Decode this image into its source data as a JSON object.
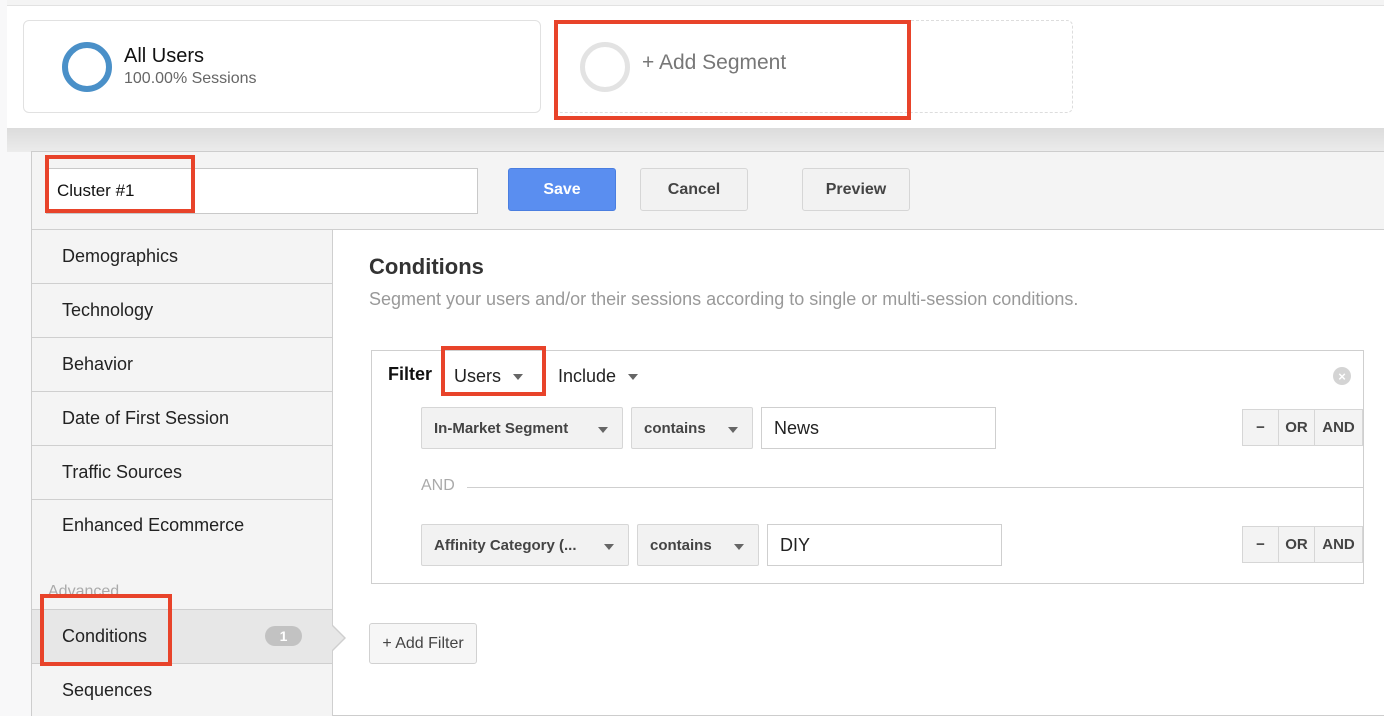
{
  "segments": {
    "active": {
      "title": "All Users",
      "subtitle": "100.00% Sessions",
      "ring_color": "#4a90c8"
    },
    "add_label": "+ Add Segment"
  },
  "editor": {
    "segment_name": "Cluster #1",
    "buttons": {
      "save": "Save",
      "cancel": "Cancel",
      "preview": "Preview"
    },
    "save_color": "#5a8ef0"
  },
  "sidebar": {
    "items": [
      {
        "label": "Demographics"
      },
      {
        "label": "Technology"
      },
      {
        "label": "Behavior"
      },
      {
        "label": "Date of First Session"
      },
      {
        "label": "Traffic Sources"
      },
      {
        "label": "Enhanced Ecommerce"
      }
    ],
    "advanced_label": "Advanced",
    "advanced_items": [
      {
        "label": "Conditions",
        "badge": "1",
        "active": true
      },
      {
        "label": "Sequences"
      }
    ]
  },
  "conditions": {
    "title": "Conditions",
    "description": "Segment your users and/or their sessions according to single or multi-session conditions.",
    "filter": {
      "label": "Filter",
      "scope": "Users",
      "mode": "Include",
      "rows": [
        {
          "dimension": "In-Market Segment",
          "operator": "contains",
          "value": "News"
        },
        {
          "dimension": "Affinity Category (...",
          "operator": "contains",
          "value": "DIY"
        }
      ],
      "separator": "AND",
      "row_buttons": {
        "minus": "−",
        "or": "OR",
        "and": "AND"
      }
    },
    "add_filter_label": "+ Add Filter"
  },
  "highlight_color": "#e8432a"
}
